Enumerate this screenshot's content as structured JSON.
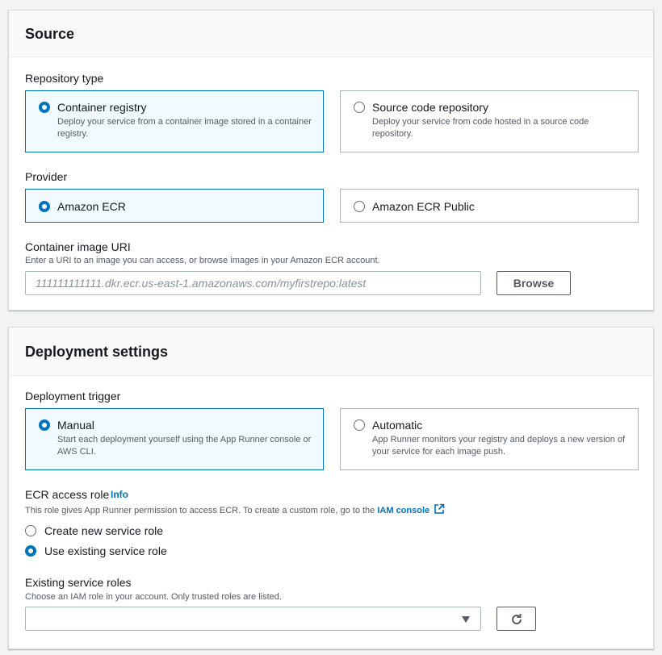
{
  "source": {
    "title": "Source",
    "repository_type": {
      "label": "Repository type",
      "options": [
        {
          "title": "Container registry",
          "description": "Deploy your service from a container image stored in a container registry.",
          "selected": true
        },
        {
          "title": "Source code repository",
          "description": "Deploy your service from code hosted in a source code repository.",
          "selected": false
        }
      ]
    },
    "provider": {
      "label": "Provider",
      "options": [
        {
          "title": "Amazon ECR",
          "selected": true
        },
        {
          "title": "Amazon ECR Public",
          "selected": false
        }
      ]
    },
    "image_uri": {
      "label": "Container image URI",
      "description": "Enter a URI to an image you can access, or browse images in your Amazon ECR account.",
      "placeholder": "111111111111.dkr.ecr.us-east-1.amazonaws.com/myfirstrepo:latest",
      "value": "",
      "browse_label": "Browse"
    }
  },
  "deployment": {
    "title": "Deployment settings",
    "trigger": {
      "label": "Deployment trigger",
      "options": [
        {
          "title": "Manual",
          "description": "Start each deployment yourself using the App Runner console or AWS CLI.",
          "selected": true
        },
        {
          "title": "Automatic",
          "description": "App Runner monitors your registry and deploys a new version of your service for each image push.",
          "selected": false
        }
      ]
    },
    "ecr_role": {
      "label": "ECR access role",
      "info": "Info",
      "description_prefix": "This role gives App Runner permission to access ECR. To create a custom role, go to the",
      "link": "IAM console",
      "options": [
        {
          "title": "Create new service role",
          "selected": false
        },
        {
          "title": "Use existing service role",
          "selected": true
        }
      ]
    },
    "existing_roles": {
      "label": "Existing service roles",
      "description": "Choose an IAM role in your account. Only trusted roles are listed.",
      "value": ""
    }
  },
  "colors": {
    "accent": "#0073bb",
    "selected_tile_bg": "#f1faff",
    "border": "#aab7b8",
    "page_bg": "#f2f3f3"
  },
  "icons": {
    "dropdown": "caret-down-icon",
    "refresh": "refresh-icon",
    "external_link": "external-link-icon"
  }
}
